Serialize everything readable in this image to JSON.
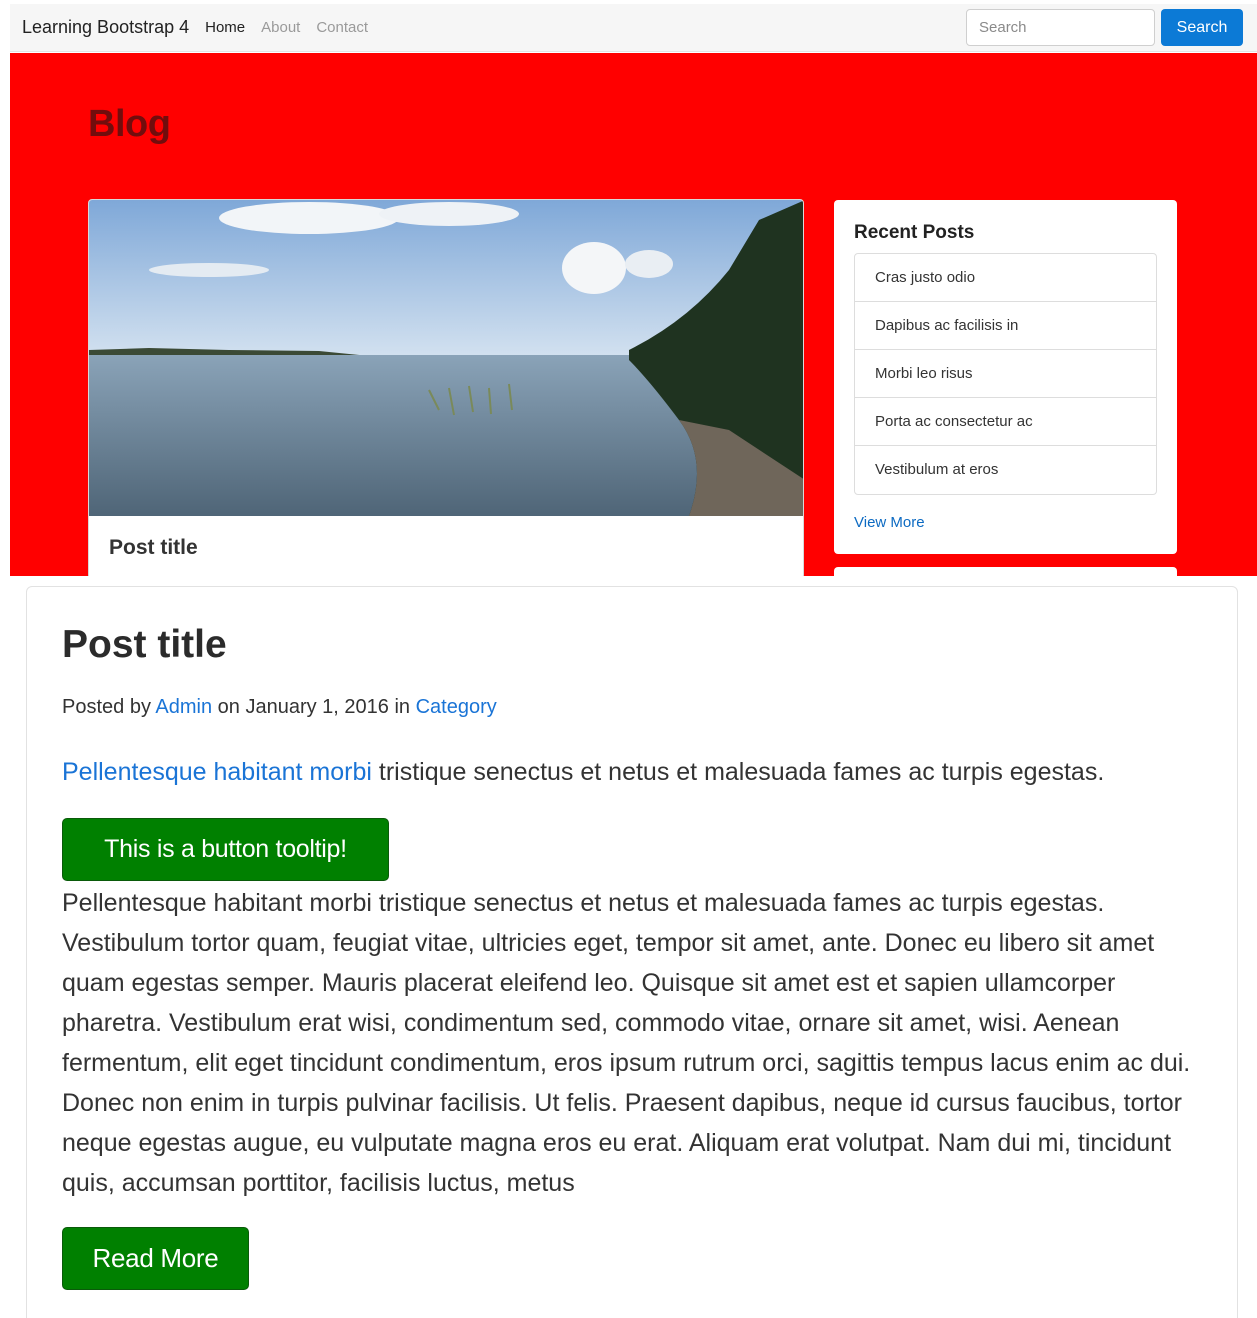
{
  "navbar": {
    "brand": "Learning Bootstrap 4",
    "links": [
      "Home",
      "About",
      "Contact"
    ],
    "search_placeholder": "Search",
    "search_button": "Search"
  },
  "hero": {
    "heading": "Blog",
    "post_card_title": "Post title"
  },
  "sidebar": {
    "title": "Recent Posts",
    "items": [
      "Cras justo odio",
      "Dapibus ac facilisis in",
      "Morbi leo risus",
      "Porta ac consectetur ac",
      "Vestibulum at eros"
    ],
    "view_more": "View More"
  },
  "post": {
    "title": "Post title",
    "meta_prefix": "Posted by",
    "author": "Admin",
    "meta_middle": "on January 1, 2016 in",
    "category": "Category",
    "lead_link": "Pellentesque habitant morbi",
    "lead_rest": " tristique senectus et netus et malesuada fames ac turpis egestas.",
    "tooltip_button": "This is a button tooltip!",
    "body": "Pellentesque habitant morbi tristique senectus et netus et malesuada fames ac turpis egestas. Vestibulum tortor quam, feugiat vitae, ultricies eget, tempor sit amet, ante. Donec eu libero sit amet quam egestas semper. Mauris placerat eleifend leo. Quisque sit amet est et sapien ullamcorper pharetra. Vestibulum erat wisi, condimentum sed, commodo vitae, ornare sit amet, wisi. Aenean fermentum, elit eget tincidunt condimentum, eros ipsum rutrum orci, sagittis tempus lacus enim ac dui. Donec non enim in turpis pulvinar facilisis. Ut felis. Praesent dapibus, neque id cursus faucibus, tortor neque egestas augue, eu vulputate magna eros eu erat. Aliquam erat volutpat. Nam dui mi, tincidunt quis, accumsan porttitor, facilisis luctus, metus",
    "read_more": "Read More"
  },
  "colors": {
    "hero_bg": "#ff0000",
    "primary": "#0c7ad6",
    "success": "#008000",
    "link": "#1a74d6"
  }
}
